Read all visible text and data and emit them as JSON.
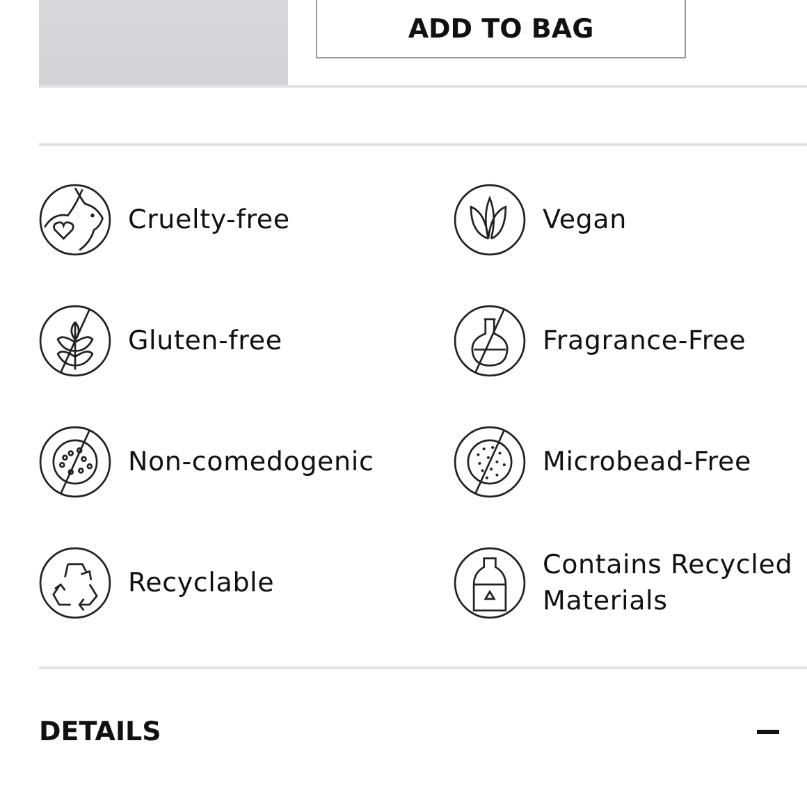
{
  "purchase": {
    "button": "ADD TO BAG"
  },
  "badges": [
    {
      "kind": "cruelty",
      "label": "Cruelty-free"
    },
    {
      "kind": "gluten",
      "label": "Gluten-free"
    },
    {
      "kind": "comedogenic",
      "label": "Non-comedogenic"
    },
    {
      "kind": "recyclable",
      "label": "Recyclable"
    },
    {
      "kind": "vegan",
      "label": "Vegan"
    },
    {
      "kind": "fragrance",
      "label": "Fragrance-Free"
    },
    {
      "kind": "microbead",
      "label": "Microbead-Free"
    },
    {
      "kind": "recycled",
      "label": "Contains Recycled Materials"
    }
  ],
  "details": {
    "title": "DETAILS",
    "expanded": true
  }
}
